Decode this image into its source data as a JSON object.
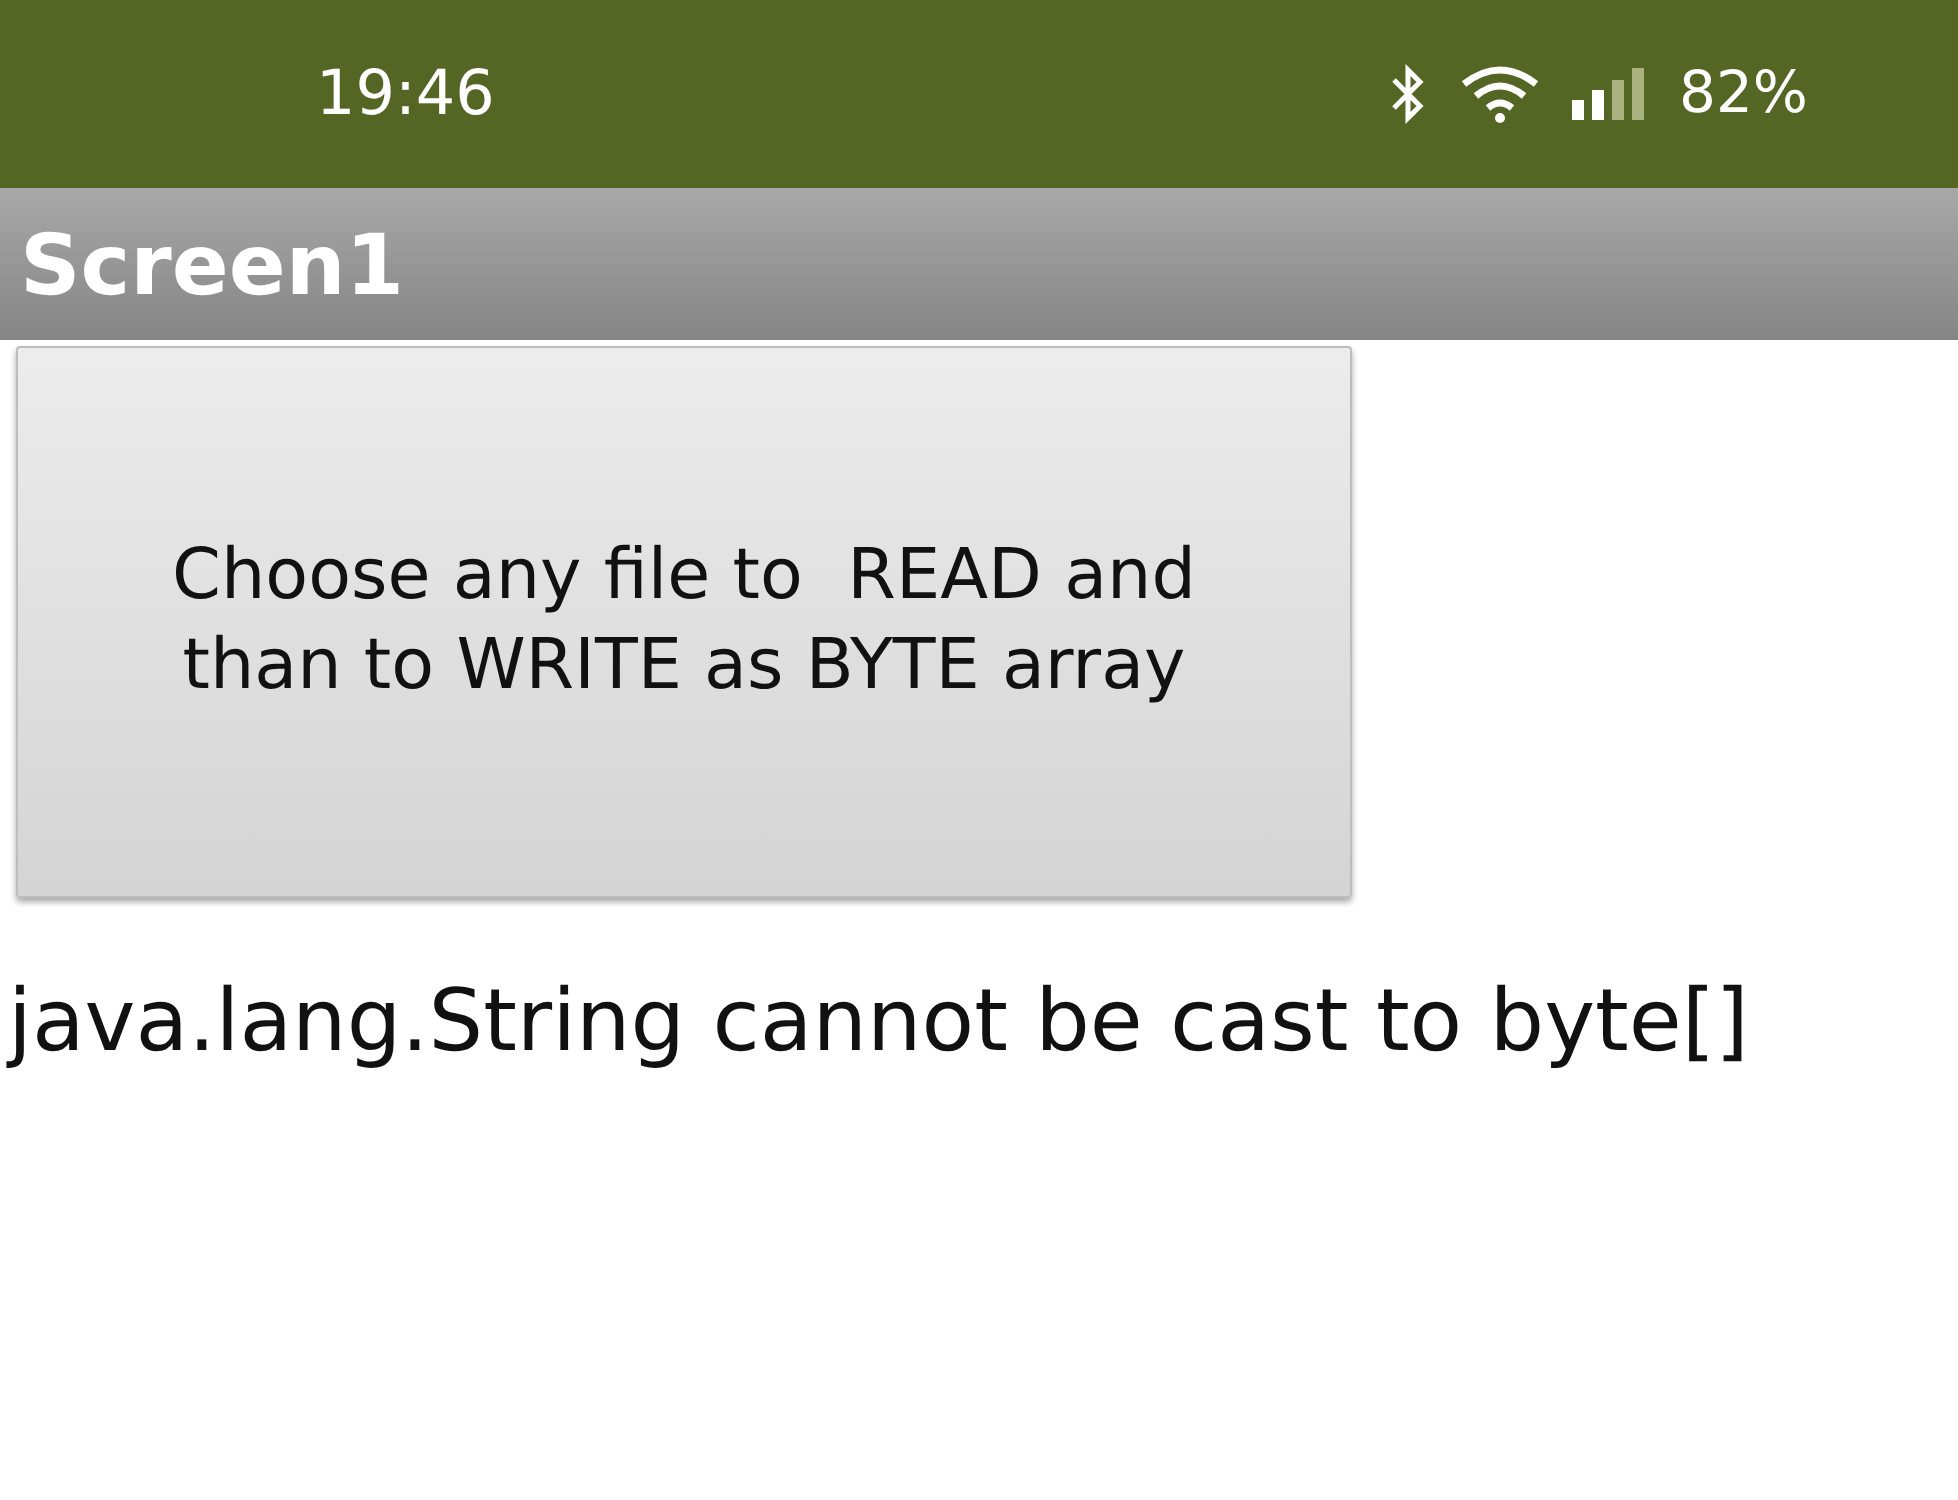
{
  "status_bar": {
    "time": "19:46",
    "battery": "82%"
  },
  "title_bar": {
    "title": "Screen1"
  },
  "button": {
    "label": "Choose any file to  READ and than to WRITE as BYTE array"
  },
  "label": {
    "text": "java.lang.String cannot be cast to byte[]"
  }
}
